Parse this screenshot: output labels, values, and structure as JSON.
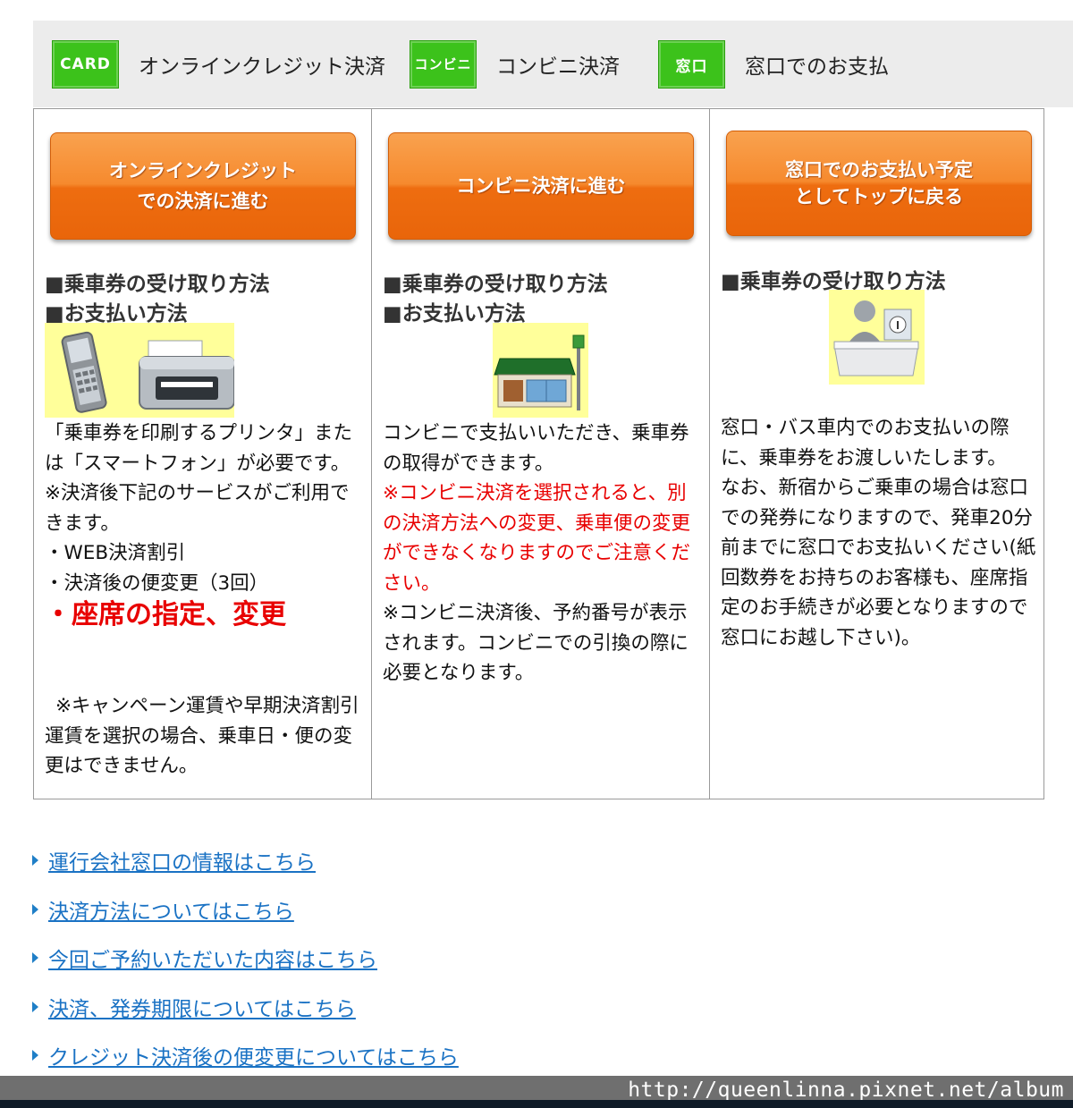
{
  "header": {
    "methods": [
      {
        "badge": "CARD",
        "label": "オンラインクレジット決済"
      },
      {
        "badge": "コンビニ",
        "label": "コンビニ決済"
      },
      {
        "badge": "窓口",
        "label": "窓口でのお支払"
      }
    ]
  },
  "columns": {
    "credit": {
      "button_line1": "オンラインクレジット",
      "button_line2": "での決済に進む",
      "receive_heading": "■乗車券の受け取り方法",
      "pay_heading": "■お支払い方法",
      "text1": "「乗車券を印刷するプリンタ」または「スマートフォン」が必要です。",
      "text2": "※決済後下記のサービスがご利用できます。",
      "text3": "・WEB決済割引",
      "text4": "・決済後の便変更（3回）",
      "text5": "・座席の指定、変更",
      "note": "※キャンペーン運賃や早期決済割引運賃を選択の場合、乗車日・便の変更はできません。"
    },
    "conv": {
      "button_line1": "コンビニ決済に進む",
      "receive_heading": "■乗車券の受け取り方法",
      "pay_heading": "■お支払い方法",
      "text1": "コンビニで支払いいただき、乗車券の取得ができます。",
      "warning": "※コンビニ決済を選択されると、別の決済方法への変更、乗車便の変更ができなくなりますのでご注意ください。",
      "text2": "※コンビニ決済後、予約番号が表示されます。コンビニでの引換の際に必要となります。"
    },
    "counter": {
      "button_line1": "窓口でのお支払い予定",
      "button_line2": "としてトップに戻る",
      "receive_heading": "■乗車券の受け取り方法",
      "text1": "窓口・バス車内でのお支払いの際に、乗車券をお渡しいたします。",
      "text2": "なお、新宿からご乗車の場合は窓口での発券になりますので、発車20分前までに窓口でお支払いください(紙回数券をお持ちのお客様も、座席指定のお手続きが必要となりますので窓口にお越し下さい)。"
    }
  },
  "links": [
    "運行会社窓口の情報はこちら",
    "決済方法についてはこちら",
    "今回ご予約いただいた内容はこちら",
    "決済、発券期限についてはこちら",
    "クレジット決済後の便変更についてはこちら"
  ],
  "footer": {
    "watermark": "http://queenlinna.pixnet.net/album"
  },
  "colors": {
    "green_badge": "#3cc21b",
    "orange_button": "#f68a2e",
    "link": "#1a72c4",
    "warning": "#e80000"
  }
}
